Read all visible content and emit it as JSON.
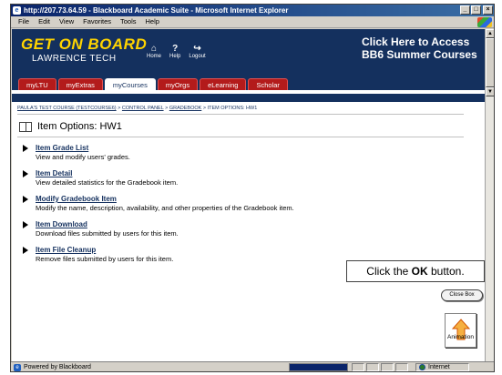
{
  "window": {
    "title": "http://207.73.64.59 - Blackboard Academic Suite - Microsoft Internet Explorer",
    "controls": [
      "_",
      "□",
      "×"
    ]
  },
  "menubar": {
    "items": [
      "File",
      "Edit",
      "View",
      "Favorites",
      "Tools",
      "Help"
    ]
  },
  "banner": {
    "brand": "GET ON BOARD",
    "brand_sub": "LAWRENCE TECH",
    "top_links": [
      {
        "icon": "home-icon",
        "glyph": "⌂",
        "label": "Home"
      },
      {
        "icon": "help-icon",
        "glyph": "?",
        "label": "Help"
      },
      {
        "icon": "logout-icon",
        "glyph": "↪",
        "label": "Logout"
      }
    ],
    "promo_line1": "Click Here to Access",
    "promo_line2": "BB6 Summer Courses",
    "background_color": "#14305e",
    "brand_color": "#ffd400",
    "tab_color": "#b31b1b"
  },
  "tabs": [
    {
      "label": "myLTU",
      "active": false
    },
    {
      "label": "myExtras",
      "active": false
    },
    {
      "label": "myCourses",
      "active": true
    },
    {
      "label": "myOrgs",
      "active": false
    },
    {
      "label": "eLearning",
      "active": false
    },
    {
      "label": "Scholar",
      "active": false
    }
  ],
  "breadcrumb": {
    "items": [
      "PAULA'S TEST COURSE (TESTCOURSE6)",
      "CONTROL PANEL",
      "GRADEBOOK",
      "ITEM OPTIONS: HW1"
    ],
    "separator": ">"
  },
  "page": {
    "title": "Item Options: HW1"
  },
  "options": [
    {
      "title": "Item Grade List",
      "desc": "View and modify users' grades."
    },
    {
      "title": "Item Detail",
      "desc": "View detailed statistics for the Gradebook item."
    },
    {
      "title": "Modify Gradebook Item",
      "desc": "Modify the name, description, availability, and other properties of the Gradebook item."
    },
    {
      "title": "Item Download",
      "desc": "Download files submitted by users for this item."
    },
    {
      "title": "Item File Cleanup",
      "desc": "Remove files submitted by users for this item."
    }
  ],
  "callout": {
    "prefix": "Click the ",
    "bold": "OK",
    "suffix": " button."
  },
  "close_button": "Close Box",
  "animation": {
    "label": "Animation"
  },
  "statusbar": {
    "left": "Powered by Blackboard",
    "zone": "Internet"
  }
}
